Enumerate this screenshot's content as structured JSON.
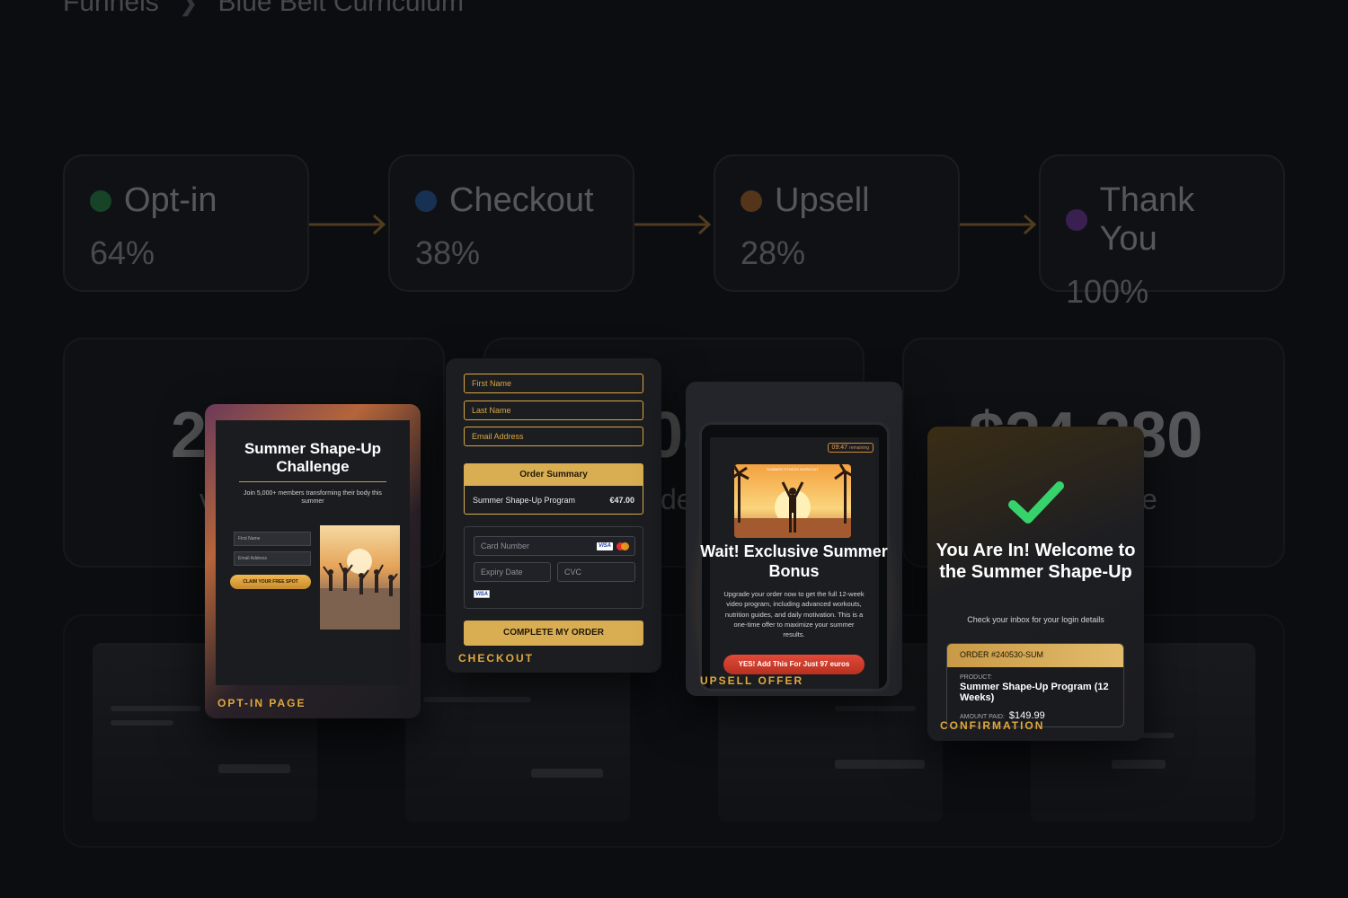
{
  "breadcrumb": {
    "root": "Funnels",
    "current": "Blue Belt Curriculum"
  },
  "stages": [
    {
      "name": "Opt-in",
      "pct": "64%",
      "color": "#2fb65a"
    },
    {
      "name": "Checkout",
      "pct": "38%",
      "color": "#2f7fe0"
    },
    {
      "name": "Upsell",
      "pct": "28%",
      "color": "#f08a2f"
    },
    {
      "name": "Thank You",
      "pct": "100%",
      "color": "#9c4ad8"
    }
  ],
  "metrics": [
    {
      "big": "2",
      "sub": "v"
    },
    {
      "big": "08",
      "sub": "de"
    },
    {
      "big": "$24,280",
      "sub": "e"
    }
  ],
  "optin": {
    "label": "OPT-IN PAGE",
    "title": "Summer Shape-Up Challenge",
    "desc": "Join 5,000+ members transforming their body this summer",
    "first_name": "First Name",
    "email": "Email Address",
    "cta": "CLAIM YOUR FREE SPOT"
  },
  "checkout": {
    "label": "CHECKOUT",
    "first_name": "First Name",
    "last_name": "Last Name",
    "email": "Email Address",
    "order_summary": "Order Summary",
    "product": "Summer Shape-Up Program",
    "price": "€47.00",
    "card_number": "Card Number",
    "expiry": "Expiry Date",
    "cvc": "CVC",
    "visa": "VISA",
    "complete": "COMPLETE MY ORDER"
  },
  "upsell": {
    "label": "UPSELL OFFER",
    "timer": "09:47",
    "timer_suffix": "remaining",
    "image_caption": "SUMMER FITNESS WORKOUT",
    "title": "Wait! Exclusive Summer Bonus",
    "desc": "Upgrade your order now to get the full 12-week video program, including advanced workouts, nutrition guides, and daily motivation. This is a one-time offer to maximize your summer results.",
    "cta": "YES! Add This For Just 97 euros"
  },
  "confirmation": {
    "label": "CONFIRMATION",
    "title": "You Are In! Welcome to the Summer Shape-Up",
    "desc": "Check your inbox for your login details",
    "order_id": "ORDER #240530-SUM",
    "product_label": "PRODUCT:",
    "product": "Summer Shape-Up Program (12 Weeks)",
    "amount_label": "AMOUNT PAID:",
    "amount": "$149.99"
  },
  "colors": {
    "accent": "#d9ae52",
    "label": "#e0a93b",
    "cta_red": "#e04a3a",
    "check_green": "#36d36c"
  }
}
